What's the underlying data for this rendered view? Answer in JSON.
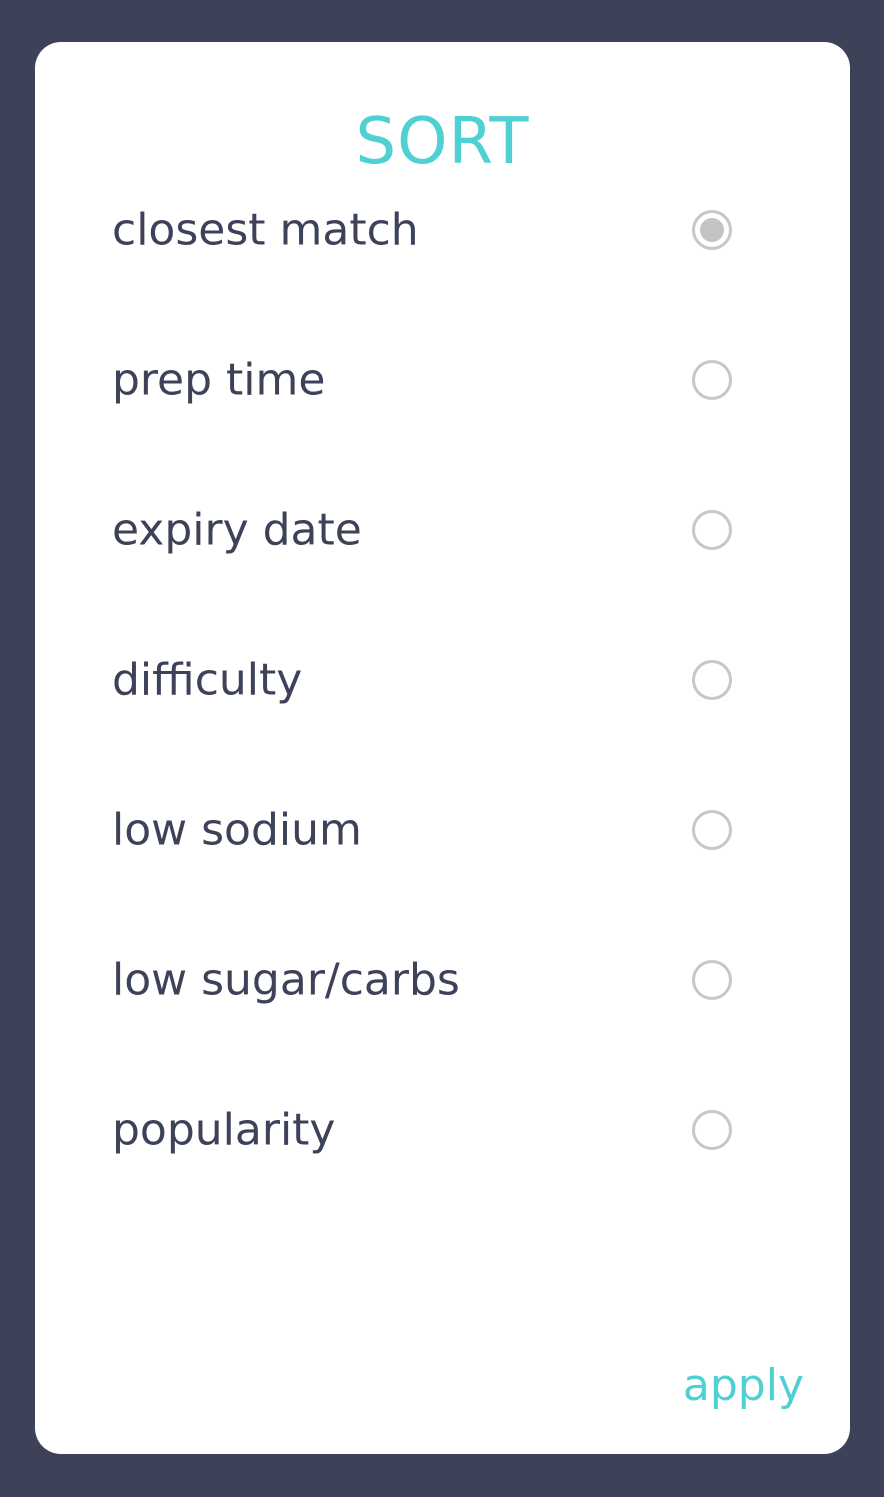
{
  "dialog": {
    "title": "SORT",
    "options": [
      {
        "label": "closest match",
        "selected": true
      },
      {
        "label": "prep time",
        "selected": false
      },
      {
        "label": "expiry date",
        "selected": false
      },
      {
        "label": "difficulty",
        "selected": false
      },
      {
        "label": "low sodium",
        "selected": false
      },
      {
        "label": "low sugar/carbs",
        "selected": false
      },
      {
        "label": "popularity",
        "selected": false
      }
    ],
    "apply_label": "apply"
  },
  "colors": {
    "background": "#3d4259",
    "accent": "#4fd1d3",
    "text": "#3d4259",
    "radio": "#c7c7c7"
  }
}
